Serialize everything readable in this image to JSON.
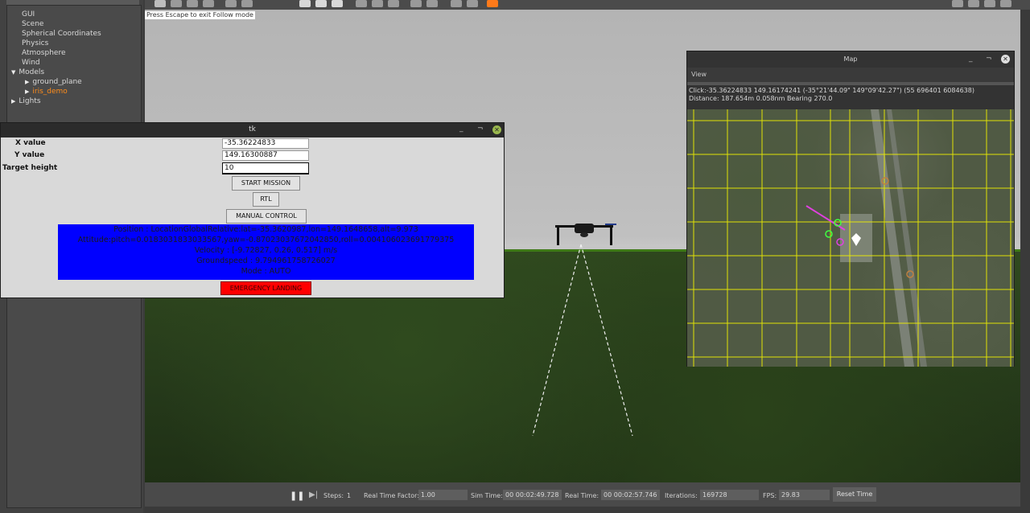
{
  "gazebo": {
    "world_tree": {
      "items": [
        {
          "label": "GUI",
          "level": 1
        },
        {
          "label": "Scene",
          "level": 1
        },
        {
          "label": "Spherical Coordinates",
          "level": 1
        },
        {
          "label": "Physics",
          "level": 1
        },
        {
          "label": "Atmosphere",
          "level": 1
        },
        {
          "label": "Wind",
          "level": 1
        },
        {
          "label": "Models",
          "level": 1,
          "expanded": true
        },
        {
          "label": "ground_plane",
          "level": 2
        },
        {
          "label": "iris_demo",
          "level": 2,
          "selected": true
        },
        {
          "label": "Lights",
          "level": 1
        }
      ]
    },
    "follow_hint": "Press Escape to exit Follow mode",
    "status": {
      "steps_label": "Steps:",
      "steps_value": "1",
      "rtf_label": "Real Time Factor:",
      "rtf_value": "1.00",
      "sim_time_label": "Sim Time:",
      "sim_time_value": "00 00:02:49.728",
      "real_time_label": "Real Time:",
      "real_time_value": "00 00:02:57.746",
      "iterations_label": "Iterations:",
      "iterations_value": "169728",
      "fps_label": "FPS:",
      "fps_value": "29.83",
      "reset_label": "Reset Time"
    }
  },
  "tk": {
    "title": "tk",
    "x_label": "X value",
    "x_value": "-35.36224833",
    "y_label": "Y value",
    "y_value": "149.16300887",
    "height_label": "Target height",
    "height_value": "10",
    "start_mission": "START MISSION",
    "rtl": "RTL",
    "manual_control": "MANUAL CONTROL",
    "telemetry": [
      "Position : LocationGlobalRelative:lat=-35.3620987,lon=149.1648658,alt=9.973",
      "Attitude:pitch=0.0183031833033567,yaw=-0.87023037672042850,roll=0.004106023691779375",
      "Velocity : [-9.72827, 0.26, 0.517] m/s",
      "Groundspeed : 9.794961758726027",
      "Mode : AUTO"
    ],
    "emergency": "EMERGENCY LANDING"
  },
  "map": {
    "title": "Map",
    "menu_view": "View",
    "click_info": "Click:-35.36224833 149.16174241 (-35°21'44.09\" 149°09'42.27\") (55 696401 6084638)",
    "distance_info": "Distance: 187.654m 0.058nm Bearing 270.0"
  }
}
